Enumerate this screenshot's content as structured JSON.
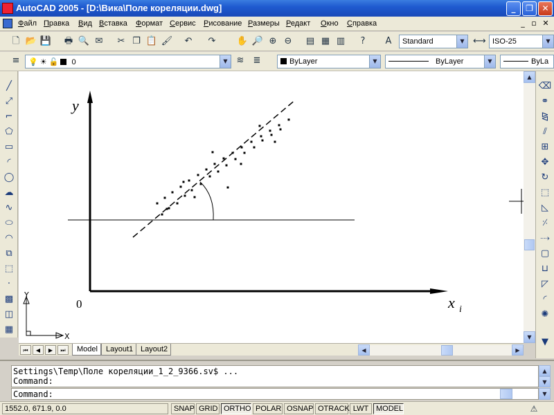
{
  "window": {
    "title": "AutoCAD 2005 - [D:\\Вика\\Поле кореляции.dwg]",
    "min_glyph": "_",
    "max_glyph": "❐",
    "close_glyph": "✕"
  },
  "menu": {
    "items": [
      {
        "hot": "Ф",
        "rest": "айл"
      },
      {
        "hot": "П",
        "rest": "равка"
      },
      {
        "hot": "В",
        "rest": "ид"
      },
      {
        "hot": "В",
        "rest": "ставка"
      },
      {
        "hot": "Ф",
        "rest": "ормат"
      },
      {
        "hot": "С",
        "rest": "ервис"
      },
      {
        "hot": "Р",
        "rest": "исование"
      },
      {
        "hot": "Р",
        "rest": "азмеры"
      },
      {
        "hot": "Р",
        "rest": "едакт"
      },
      {
        "hot": "О",
        "rest": "кно"
      },
      {
        "hot": "С",
        "rest": "правка"
      }
    ],
    "doc_min": "_",
    "doc_restore": "▫",
    "doc_close": "✕"
  },
  "styles": {
    "text_style": "Standard",
    "dim_style": "ISO-25"
  },
  "layers": {
    "current_layer": "0",
    "color": "ByLayer",
    "linetype": "ByLayer",
    "lineweight": "ByLa"
  },
  "drawing": {
    "y_label": "y",
    "x_label": "x",
    "x_subscript": "i",
    "origin_label": "0",
    "ucs_x": "X",
    "ucs_y": "Y",
    "accent": "#000000"
  },
  "tabs": [
    "Model",
    "Layout1",
    "Layout2"
  ],
  "command": {
    "history_line1": "Settings\\Temp\\Поле кореляции_1_2_9366.sv$ ...",
    "history_line2": "Command:",
    "prompt": "Command:"
  },
  "status": {
    "coords": "1552.0, 671.9, 0.0",
    "buttons": [
      "SNAP",
      "GRID",
      "ORTHO",
      "POLAR",
      "OSNAP",
      "OTRACK",
      "LWT",
      "MODEL"
    ]
  }
}
